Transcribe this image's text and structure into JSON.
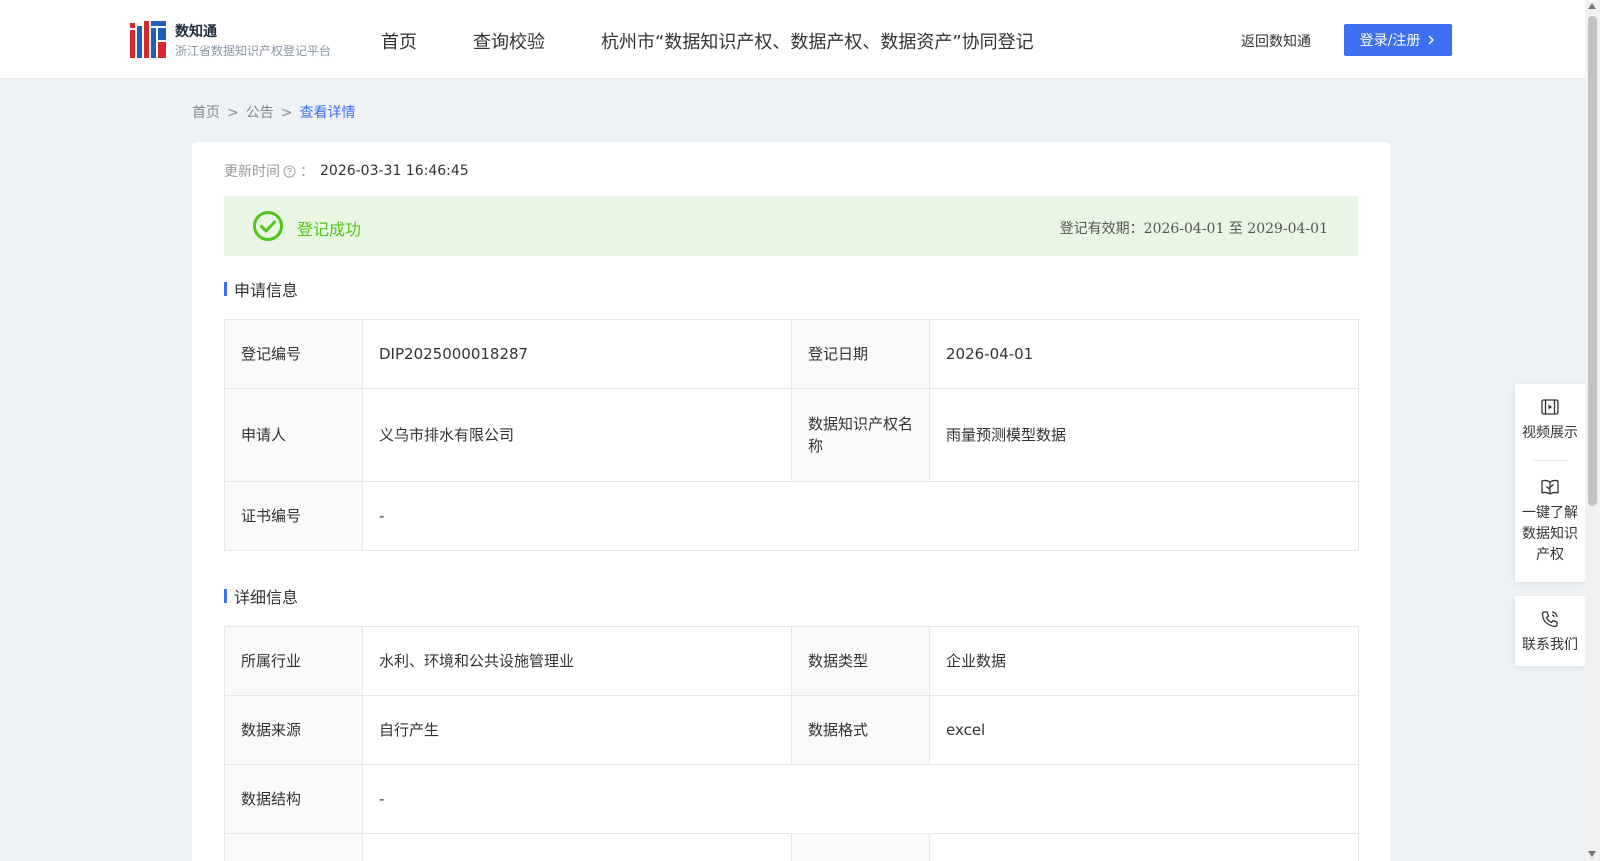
{
  "header": {
    "brand_name": "数知通",
    "brand_subtitle": "浙江省数据知识产权登记平台",
    "nav": [
      "首页",
      "查询校验",
      "杭州市“数据知识产权、数据产权、数据资产”协同登记"
    ],
    "back_link": "返回数知通",
    "login_label": "登录/注册",
    "accent_color": "#3d6ff2"
  },
  "breadcrumb": {
    "items": [
      "首页",
      "公告",
      "查看详情"
    ],
    "separator": ">"
  },
  "update": {
    "label": "更新时间",
    "colon": "：",
    "value": "2026-03-31 16:46:45"
  },
  "status": {
    "text": "登记成功",
    "valid_label": "登记有效期：",
    "valid_from": "2026-04-01",
    "valid_to_word": "至",
    "valid_to": "2029-04-01",
    "color": "#52c41a"
  },
  "apply_section": {
    "title": "申请信息",
    "reg_no_label": "登记编号",
    "reg_no": "DIP2025000018287",
    "reg_date_label": "登记日期",
    "reg_date": "2026-04-01",
    "applicant_label": "申请人",
    "applicant": "义乌市排水有限公司",
    "ip_name_label": "数据知识产权名称",
    "ip_name": "雨量预测模型数据",
    "cert_no_label": "证书编号",
    "cert_no": "-"
  },
  "detail_section": {
    "title": "详细信息",
    "industry_label": "所属行业",
    "industry": "水利、环境和公共设施管理业",
    "data_type_label": "数据类型",
    "data_type": "企业数据",
    "source_label": "数据来源",
    "source": "自行产生",
    "format_label": "数据格式",
    "format": "excel",
    "structure_label": "数据结构",
    "structure": "-"
  },
  "side": {
    "video": "视频展示",
    "learn": "一键了解数据知识产权",
    "contact": "联系我们"
  }
}
